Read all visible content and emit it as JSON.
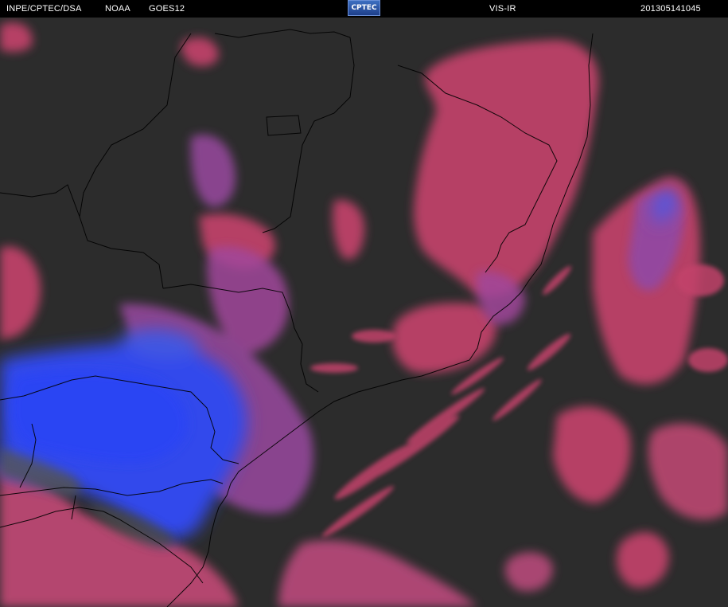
{
  "header": {
    "agency": "INPE/CPTEC/DSA",
    "source": "NOAA",
    "satellite": "GOES12",
    "logo_text": "CPTEC",
    "product": "VIS-IR",
    "timestamp": "201305141045"
  },
  "colors": {
    "background": "#2c2c2c",
    "header_bg": "#000000",
    "cloud_low": "#c2436b",
    "cloud_mid": "#a14a9c",
    "cloud_high": "#2f47f0",
    "borders": "#000000"
  }
}
